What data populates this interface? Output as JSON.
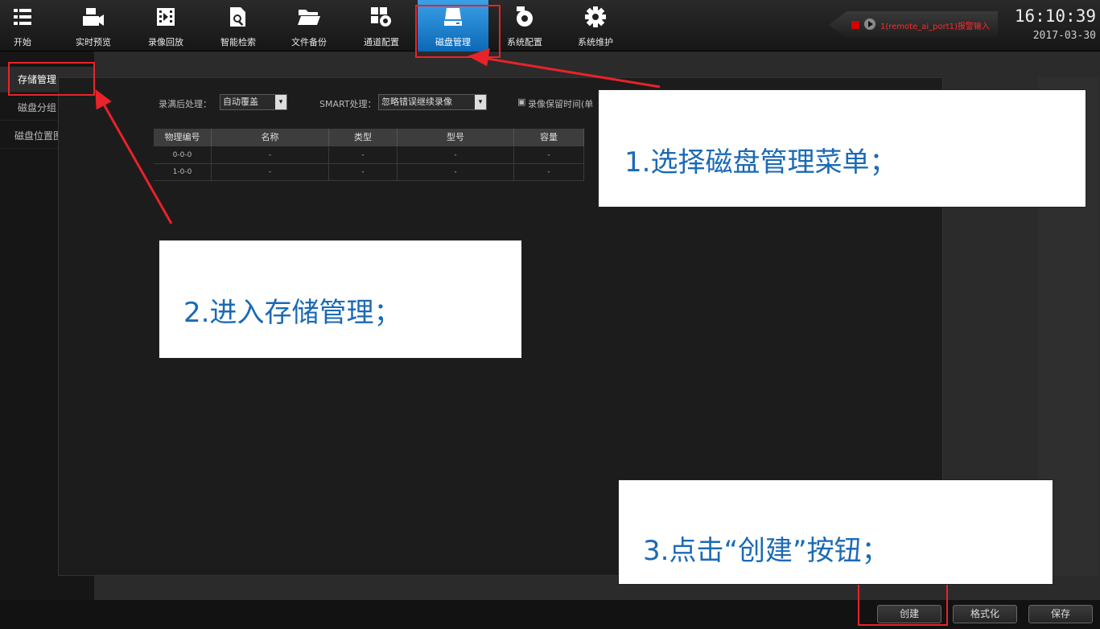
{
  "nav": [
    {
      "label": "开始",
      "icon": "menu-icon"
    },
    {
      "label": "实时预览",
      "icon": "camera-icon"
    },
    {
      "label": "录像回放",
      "icon": "film-icon"
    },
    {
      "label": "智能检索",
      "icon": "search-file-icon"
    },
    {
      "label": "文件备份",
      "icon": "folder-icon"
    },
    {
      "label": "通道配置",
      "icon": "channel-config-icon"
    },
    {
      "label": "磁盘管理",
      "icon": "disk-icon"
    },
    {
      "label": "系统配置",
      "icon": "system-config-icon"
    },
    {
      "label": "系统维护",
      "icon": "gear-icon"
    }
  ],
  "alarm": {
    "text": "1(remote_ai_port1)报警输入"
  },
  "clock": {
    "time": "16:10:39",
    "date": "2017-03-30"
  },
  "sidebar": {
    "items": [
      {
        "label": "存储管理"
      },
      {
        "label": "磁盘分组"
      },
      {
        "label": "磁盘位置图"
      }
    ]
  },
  "options": {
    "record_full_label": "录满后处理：",
    "record_full_value": "自动覆盖",
    "smart_label": "SMART处理：",
    "smart_value": "忽略错误继续录像",
    "retention_label": "录像保留时间(单"
  },
  "table": {
    "headers": [
      "物理编号",
      "名称",
      "类型",
      "型号",
      "容量"
    ],
    "rows": [
      [
        "0-0-0",
        "-",
        "-",
        "-",
        "-"
      ],
      [
        "1-0-0",
        "-",
        "-",
        "-",
        "-"
      ]
    ]
  },
  "buttons": {
    "create": "创建",
    "format": "格式化",
    "save": "保存"
  },
  "callouts": {
    "step1": "1.选择磁盘管理菜单；",
    "step2": "2.进入存储管理；",
    "step3": "3.点击“创建”按钮；"
  },
  "colors": {
    "active_tab": "#1a7fd0",
    "annotation_red": "#e8232a",
    "callout_text": "#1b6ab5"
  }
}
